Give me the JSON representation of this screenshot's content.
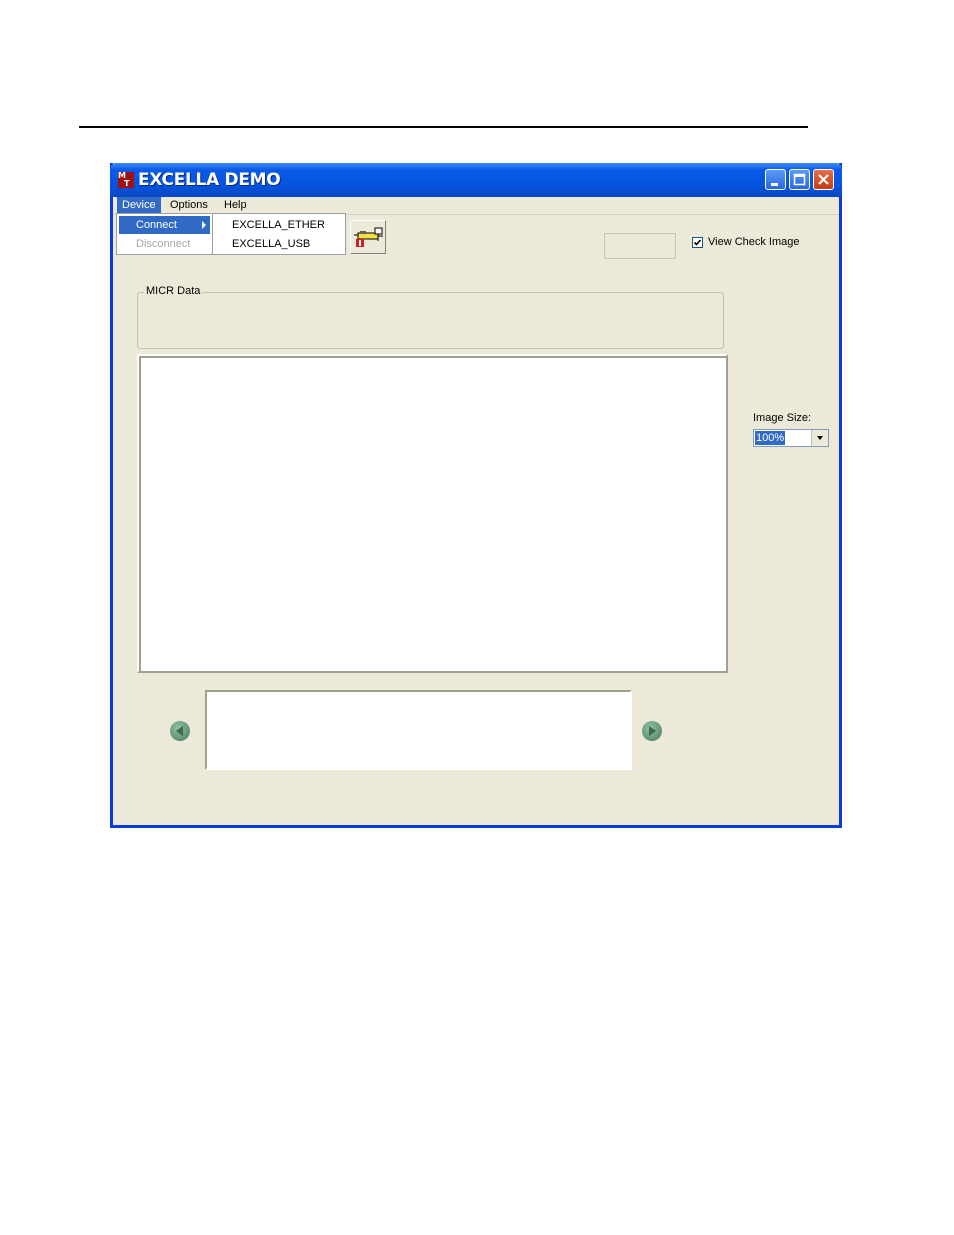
{
  "window": {
    "title": "EXCELLA DEMO",
    "icon_letters": [
      "M",
      "T"
    ]
  },
  "menubar": {
    "device": "Device",
    "options": "Options",
    "help": "Help"
  },
  "device_menu": {
    "connect": "Connect",
    "disconnect": "Disconnect"
  },
  "connect_submenu": {
    "ether": "EXCELLA_ETHER",
    "usb": "EXCELLA_USB"
  },
  "view_check_image": {
    "label": "View Check Image",
    "checked": true
  },
  "micr": {
    "label": "MICR Data"
  },
  "image_size": {
    "label": "Image Size:",
    "value": "100%"
  },
  "icons": {
    "toolbar": "scanner-connect-icon",
    "prev": "left-arrow-icon",
    "next": "right-arrow-icon"
  },
  "colors": {
    "titlebar": "#0655e0",
    "selection": "#316ac5",
    "window_bg": "#ece9d8"
  }
}
